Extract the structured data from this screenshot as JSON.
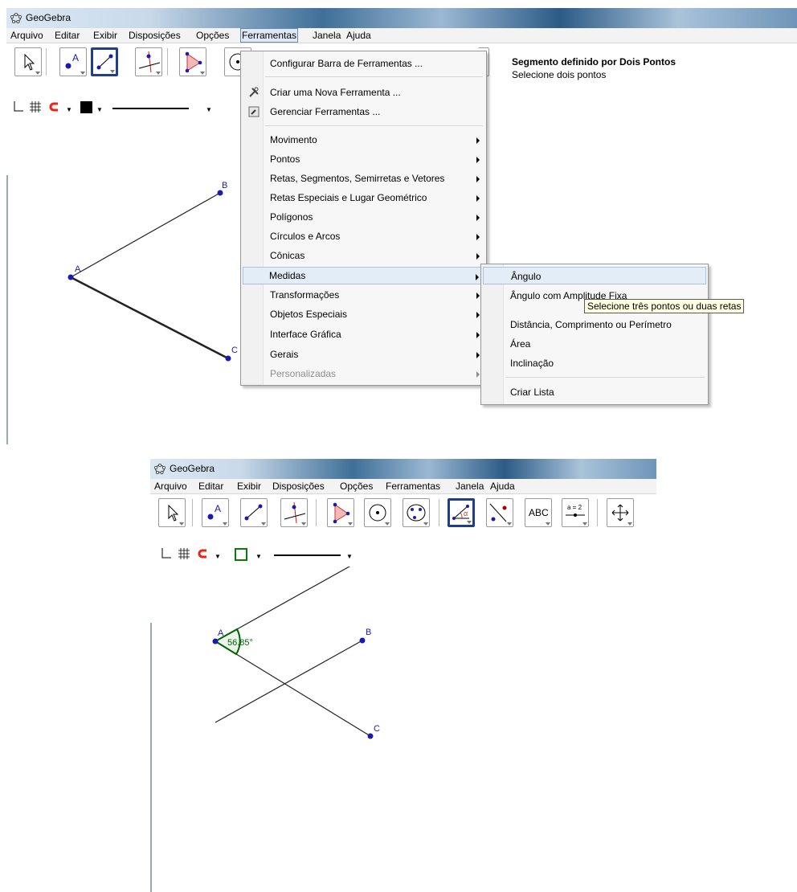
{
  "window1": {
    "title": "GeoGebra",
    "menu": [
      "Arquivo",
      "Editar",
      "Exibir",
      "Disposições",
      "Opções",
      "Ferramentas",
      "Janela",
      "Ajuda"
    ],
    "open_menu": "Ferramentas",
    "help": {
      "title": "Segmento definido por Dois Pontos",
      "subtitle": "Selecione dois pontos"
    },
    "ferramentas_menu": {
      "items": [
        {
          "label": "Configurar Barra de Ferramentas ...",
          "submenu": false,
          "icon": ""
        },
        {
          "label": "Criar uma Nova Ferramenta ...",
          "submenu": false,
          "icon": "tools-icon"
        },
        {
          "label": "Gerenciar Ferramentas ...",
          "submenu": false,
          "icon": "manage-tools-icon"
        },
        {
          "label": "Movimento",
          "submenu": true
        },
        {
          "label": "Pontos",
          "submenu": true
        },
        {
          "label": "Retas, Segmentos, Semirretas e Vetores",
          "submenu": true
        },
        {
          "label": "Retas Especiais e Lugar Geométrico",
          "submenu": true
        },
        {
          "label": "Polígonos",
          "submenu": true
        },
        {
          "label": "Círculos e Arcos",
          "submenu": true
        },
        {
          "label": "Cônicas",
          "submenu": true
        },
        {
          "label": "Medidas",
          "submenu": true,
          "highlighted": true
        },
        {
          "label": "Transformações",
          "submenu": true
        },
        {
          "label": "Objetos Especiais",
          "submenu": true
        },
        {
          "label": "Interface Gráfica",
          "submenu": true
        },
        {
          "label": "Gerais",
          "submenu": true
        },
        {
          "label": "Personalizadas",
          "submenu": true,
          "disabled": true
        }
      ]
    },
    "medidas_submenu": {
      "items": [
        "Ângulo",
        "Ângulo com Amplitude Fixa",
        "Distância, Comprimento ou Perímetro",
        "Área",
        "Inclinação",
        "Criar Lista"
      ],
      "highlighted": "Ângulo"
    },
    "tooltip": "Selecione três pontos ou duas retas",
    "points": {
      "a": "A",
      "b": "B",
      "c": "C"
    }
  },
  "window2": {
    "title": "GeoGebra",
    "menu": [
      "Arquivo",
      "Editar",
      "Exibir",
      "Disposições",
      "Opções",
      "Ferramentas",
      "Janela",
      "Ajuda"
    ],
    "tool_labels": {
      "text": "ABC",
      "slider": "a = 2"
    },
    "points": {
      "a": "A",
      "b": "B",
      "c": "C"
    },
    "angle_label": "56.85°"
  },
  "colors": {
    "point": "#1a1aaf",
    "angle": "#006400",
    "selected_tool": "#1f3f8e",
    "menu_highlight": "#e4ecf7"
  }
}
